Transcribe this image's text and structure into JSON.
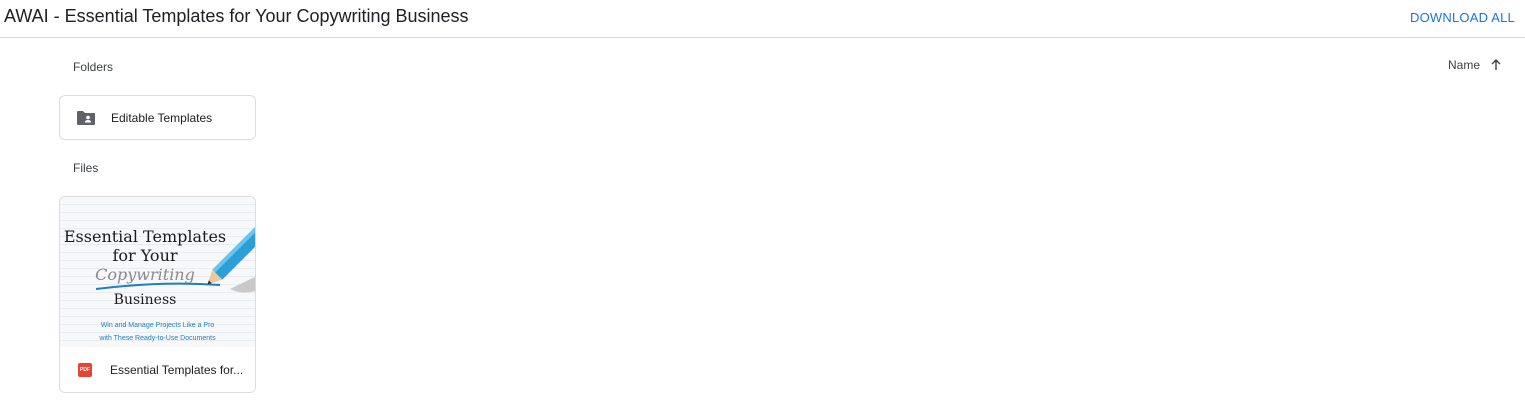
{
  "header": {
    "title": "AWAI - Essential Templates for Your Copywriting Business",
    "download_all_label": "DOWNLOAD ALL"
  },
  "sort": {
    "label": "Name",
    "direction_icon": "arrow-up-icon"
  },
  "folders": {
    "section_label": "Folders",
    "items": [
      {
        "label": "Editable Templates",
        "icon": "shared-folder-icon"
      }
    ]
  },
  "files": {
    "section_label": "Files",
    "items": [
      {
        "name": "Essential Templates for...",
        "type_badge": "PDF",
        "icon": "pdf-icon",
        "thumbnail": {
          "title_lines": [
            "Essential Templates",
            "for Your",
            "Copywriting",
            "Business"
          ],
          "subtitle_lines": [
            "Win and Manage Projects Like a Pro",
            "with These Ready-to-Use Documents"
          ]
        }
      }
    ]
  },
  "colors": {
    "accent": "#1a73e8",
    "border": "#dadce0",
    "pdf_red": "#ea4335",
    "thumb_blue": "#1f7fc2"
  }
}
